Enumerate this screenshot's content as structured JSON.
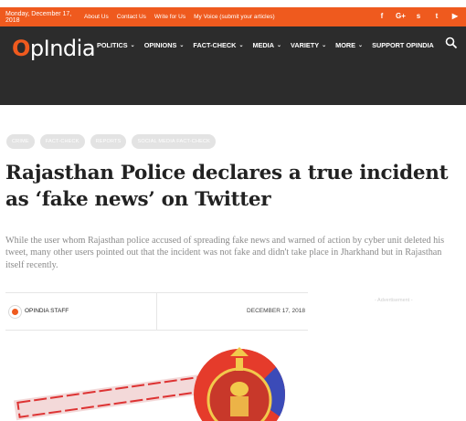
{
  "topbar": {
    "date": "Monday, December 17, 2018",
    "links": [
      "About Us",
      "Contact Us",
      "Write for Us",
      "My Voice (submit your articles)"
    ],
    "social_icons": [
      "facebook-icon",
      "google-plus-icon",
      "rss-icon",
      "twitter-icon",
      "youtube-icon"
    ],
    "social_glyphs": [
      "f",
      "G+",
      "ѕ",
      "t",
      "▶"
    ],
    "bg_color": "#ef5a1e"
  },
  "header": {
    "logo_mark": "O",
    "logo_text": "pIndia",
    "nav": [
      {
        "label": "POLITICS",
        "has_menu": true
      },
      {
        "label": "OPINIONS",
        "has_menu": true
      },
      {
        "label": "FACT-CHECK",
        "has_menu": true
      },
      {
        "label": "MEDIA",
        "has_menu": true
      },
      {
        "label": "VARIETY",
        "has_menu": true
      },
      {
        "label": "MORE",
        "has_menu": true
      },
      {
        "label": "SUPPORT OPINDIA",
        "has_menu": false
      }
    ],
    "bg_color": "#2c2c2c"
  },
  "article": {
    "tags": [
      "CRIME",
      "FACT-CHECK",
      "REPORTS",
      "SOCIAL MEDIA FACT-CHECK"
    ],
    "title": "Rajasthan Police declares a true incident as ‘fake news’ on Twitter",
    "excerpt": "While the user whom Rajasthan police accused of spreading fake news and warned of action by cyber unit deleted his tweet, many other users pointed out that the incident was not fake and didn't take place in Jharkhand but in Rajasthan itself recently.",
    "author": "OPINDIA STAFF",
    "date": "DECEMBER 17, 2018"
  },
  "sidebar": {
    "ad_label": "- Advertisement -"
  }
}
